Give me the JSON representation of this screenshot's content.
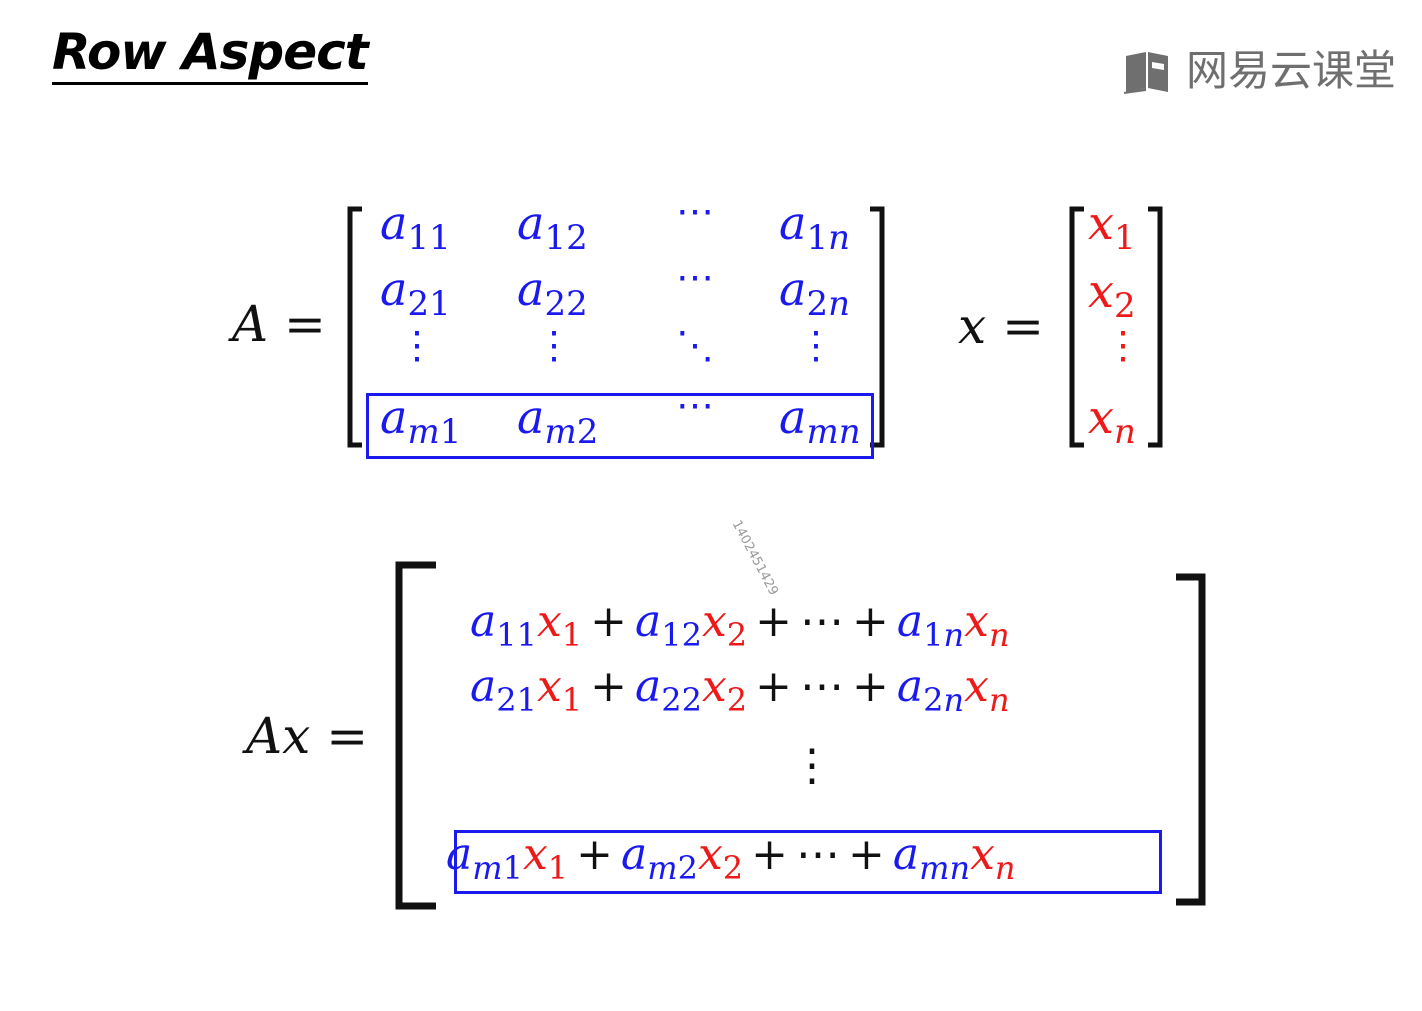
{
  "title": "Row Aspect",
  "logo": {
    "text": "网易云课堂",
    "icon": "book-logo-icon",
    "color": "#6f6f6f"
  },
  "watermark": "1402451429",
  "colors": {
    "a_entries": "#1a1aee",
    "x_entries": "#ee1a1a",
    "highlight_box": "#1a1aee",
    "text": "#111111"
  },
  "matrix_A": {
    "lhs": "A =",
    "rows": [
      [
        {
          "sym": "a",
          "sub": "11"
        },
        {
          "sym": "a",
          "sub": "12"
        },
        {
          "dots": "⋯"
        },
        {
          "sym": "a",
          "sub": "1n"
        }
      ],
      [
        {
          "sym": "a",
          "sub": "21"
        },
        {
          "sym": "a",
          "sub": "22"
        },
        {
          "dots": "⋯"
        },
        {
          "sym": "a",
          "sub": "2n"
        }
      ],
      [
        {
          "dots": "⋮"
        },
        {
          "dots": "⋮"
        },
        {
          "dots": "⋱"
        },
        {
          "dots": "⋮"
        }
      ],
      [
        {
          "sym": "a",
          "sub": "m1"
        },
        {
          "sym": "a",
          "sub": "m2"
        },
        {
          "dots": "⋯"
        },
        {
          "sym": "a",
          "sub": "mn"
        }
      ]
    ],
    "highlighted_row": "m"
  },
  "vector_x": {
    "lhs": "x =",
    "entries": [
      {
        "sym": "x",
        "sub": "1"
      },
      {
        "sym": "x",
        "sub": "2"
      },
      {
        "dots": "⋮"
      },
      {
        "sym": "x",
        "sub": "n"
      }
    ]
  },
  "product": {
    "lhs": "Ax =",
    "plus": "+",
    "ellipsis": "⋯",
    "vdots": "⋮",
    "rows": [
      {
        "terms": [
          {
            "a": "11",
            "x": "1"
          },
          {
            "a": "12",
            "x": "2"
          },
          {
            "a": "1n",
            "x": "n"
          }
        ]
      },
      {
        "terms": [
          {
            "a": "21",
            "x": "1"
          },
          {
            "a": "22",
            "x": "2"
          },
          {
            "a": "2n",
            "x": "n"
          }
        ]
      },
      {
        "terms": [
          {
            "a": "m1",
            "x": "1"
          },
          {
            "a": "m2",
            "x": "2"
          },
          {
            "a": "mn",
            "x": "n"
          }
        ]
      }
    ],
    "highlighted_row": "m"
  },
  "symbols": {
    "a": "a",
    "x": "x"
  }
}
